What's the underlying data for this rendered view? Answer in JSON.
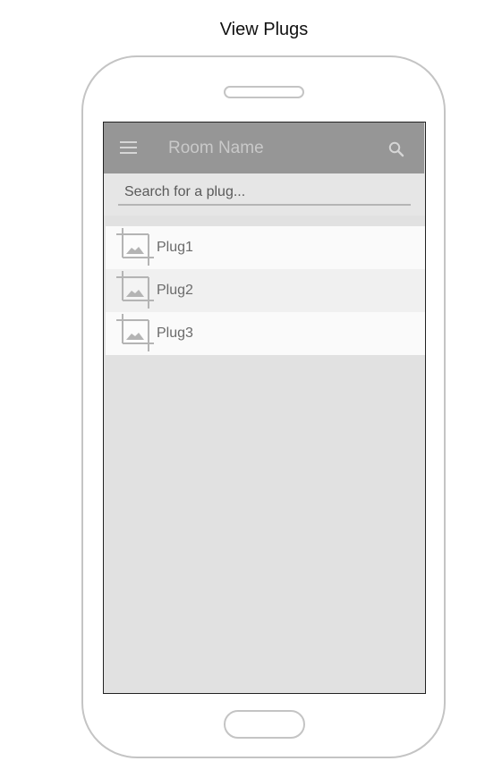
{
  "page": {
    "title": "View Plugs"
  },
  "app_bar": {
    "title": "Room Name",
    "menu_icon": "hamburger-menu-icon",
    "search_icon": "search-icon"
  },
  "search": {
    "placeholder": "Search for a plug...",
    "value": ""
  },
  "plugs": [
    {
      "label": "Plug1",
      "icon": "image-placeholder-icon"
    },
    {
      "label": "Plug2",
      "icon": "image-placeholder-icon"
    },
    {
      "label": "Plug3",
      "icon": "image-placeholder-icon"
    }
  ],
  "colors": {
    "app_bar": "#969696",
    "screen_background": "#e1e1e1",
    "row_light": "#fafafa",
    "row_dark": "#f0f0f0",
    "device_outline": "#c4c4c4"
  }
}
